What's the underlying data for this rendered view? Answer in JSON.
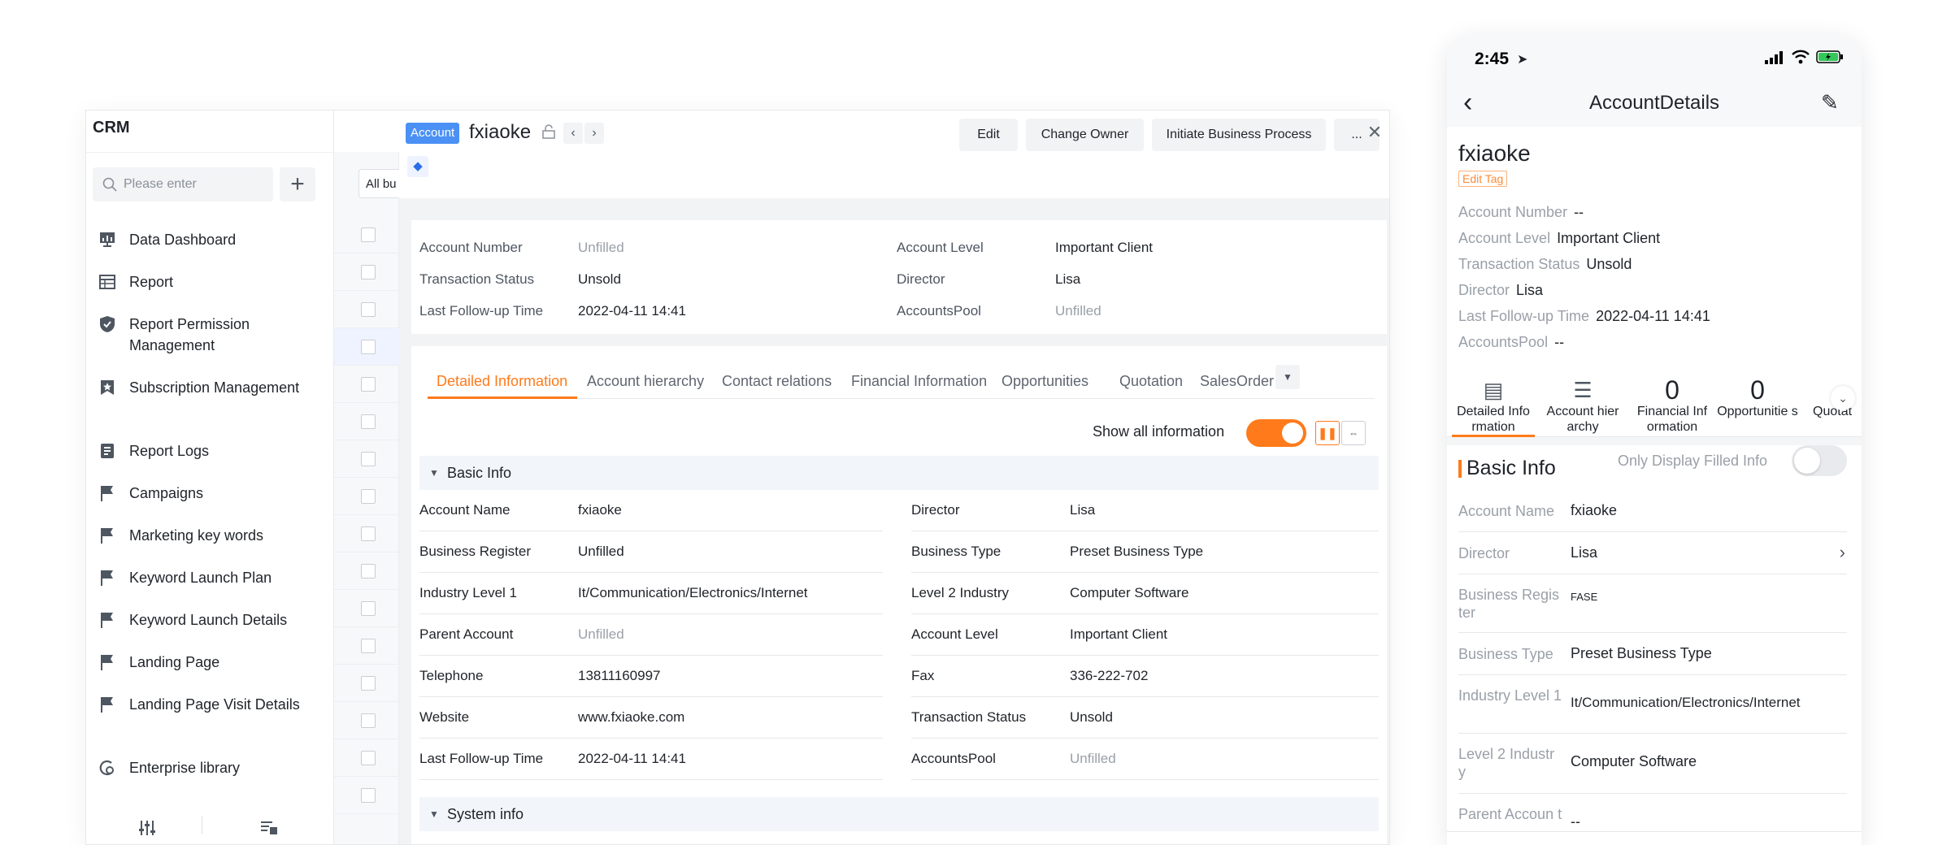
{
  "sidebar": {
    "title": "CRM",
    "search_placeholder": "Please enter",
    "add_label": "+",
    "items": [
      {
        "label": "Data Dashboard"
      },
      {
        "label": "Report"
      },
      {
        "label": "Report Permission Management"
      },
      {
        "label": "Subscription Management"
      },
      {
        "label": "Report Logs"
      },
      {
        "label": "Campaigns"
      },
      {
        "label": "Marketing key words"
      },
      {
        "label": "Keyword Launch Plan"
      },
      {
        "label": "Keyword Launch Details"
      },
      {
        "label": "Landing Page"
      },
      {
        "label": "Landing Page Visit Details"
      },
      {
        "label": "Enterprise library"
      }
    ]
  },
  "list": {
    "filter_label": "All bu"
  },
  "detail": {
    "object_badge": "Account",
    "name": "fxiaoke",
    "prev": "‹",
    "next": "›",
    "buttons": {
      "edit": "Edit",
      "change_owner": "Change Owner",
      "initiate": "Initiate Business Process",
      "more": "..."
    },
    "summary": [
      {
        "label": "Account Number",
        "value": "Unfilled",
        "empty": true
      },
      {
        "label": "Account Level",
        "value": "Important Client",
        "empty": false
      },
      {
        "label": "Transaction Status",
        "value": "Unsold",
        "empty": false
      },
      {
        "label": "Director",
        "value": "Lisa",
        "empty": false
      },
      {
        "label": "Last Follow-up Time",
        "value": "2022-04-11 14:41",
        "empty": false
      },
      {
        "label": "AccountsPool",
        "value": "Unfilled",
        "empty": true
      }
    ],
    "tabs": [
      "Detailed Information",
      "Account hierarchy",
      "Contact relations",
      "Financial Information",
      "Opportunities",
      "Quotation",
      "SalesOrder"
    ],
    "show_all_label": "Show all information",
    "show_all_on": true,
    "section_basic": "Basic Info",
    "section_system": "System info",
    "fields_left": [
      {
        "label": "Account Name",
        "value": "fxiaoke",
        "empty": false
      },
      {
        "label": "Business Register",
        "value": "Unfilled",
        "empty": false
      },
      {
        "label": "Industry Level 1",
        "value": "It/Communication/Electronics/Internet",
        "empty": false
      },
      {
        "label": "Parent Account",
        "value": "Unfilled",
        "empty": true
      },
      {
        "label": "Telephone",
        "value": "13811160997",
        "empty": false
      },
      {
        "label": "Website",
        "value": "www.fxiaoke.com",
        "empty": false
      },
      {
        "label": "Last Follow-up Time",
        "value": "2022-04-11 14:41",
        "empty": false
      }
    ],
    "fields_right": [
      {
        "label": "Director",
        "value": "Lisa",
        "empty": false
      },
      {
        "label": "Business Type",
        "value": "Preset Business Type",
        "empty": false
      },
      {
        "label": "Level 2 Industry",
        "value": "Computer Software",
        "empty": false
      },
      {
        "label": "Account Level",
        "value": "Important Client",
        "empty": false
      },
      {
        "label": "Fax",
        "value": "336-222-702",
        "empty": false
      },
      {
        "label": "Transaction Status",
        "value": "Unsold",
        "empty": false
      },
      {
        "label": "AccountsPool",
        "value": "Unfilled",
        "empty": true
      }
    ]
  },
  "mobile": {
    "time": "2:45",
    "title": "AccountDetails",
    "name": "fxiaoke",
    "edit_tag": "Edit Tag",
    "summary": [
      {
        "label": "Account Number",
        "value": "--"
      },
      {
        "label": "Account Level",
        "value": "Important Client"
      },
      {
        "label": "Transaction Status",
        "value": "Unsold"
      },
      {
        "label": "Director",
        "value": "Lisa"
      },
      {
        "label": "Last Follow-up Time",
        "value": "2022-04-11 14:41"
      },
      {
        "label": "AccountsPool",
        "value": "--"
      }
    ],
    "tabs": [
      {
        "label": "Detailed Info rmation",
        "count": ""
      },
      {
        "label": "Account hier archy",
        "count": ""
      },
      {
        "label": "Financial Inf ormation",
        "count": "0"
      },
      {
        "label": "Opportunitie s",
        "count": "0"
      },
      {
        "label": "Quotat",
        "count": ""
      }
    ],
    "section": "Basic Info",
    "only_filled_label": "Only Display Filled Info",
    "only_filled_on": false,
    "fields": [
      {
        "label": "Account Name",
        "value": "fxiaoke"
      },
      {
        "label": "Director",
        "value": "Lisa"
      },
      {
        "label": "Business Regis ter",
        "value": "FASE"
      },
      {
        "label": "Business Type",
        "value": "Preset Business Type"
      },
      {
        "label": "Industry Level 1",
        "value": "It/Communication/Electronics/Internet"
      },
      {
        "label": "Level 2 Industr y",
        "value": "Computer Software"
      },
      {
        "label": "Parent Accoun t",
        "value": "--"
      }
    ]
  },
  "colors": {
    "accent": "#ff7a1a",
    "badge_blue": "#4a90f5"
  }
}
